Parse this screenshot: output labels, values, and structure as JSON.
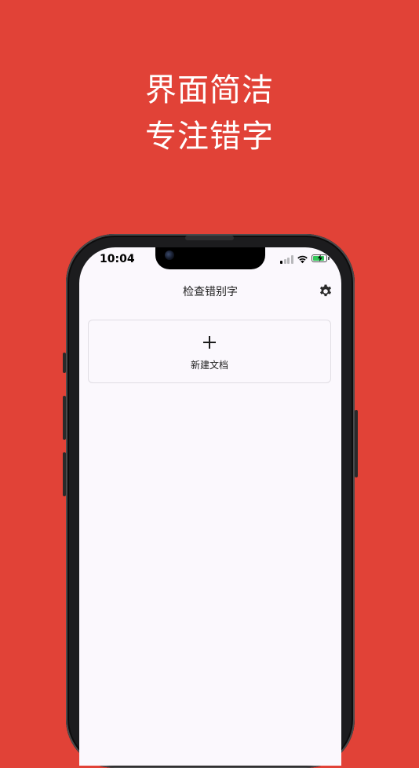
{
  "headline": {
    "line1": "界面简洁",
    "line2": "专注错字"
  },
  "status_bar": {
    "time": "10:04",
    "signal_icon": "cellular-signal-icon",
    "wifi_icon": "wifi-icon",
    "battery_icon": "battery-charging-icon",
    "battery_level": 0.85
  },
  "app": {
    "title": "检查错别字",
    "settings_icon": "gear-icon",
    "new_document": {
      "icon": "plus-icon",
      "label": "新建文档"
    }
  },
  "colors": {
    "background": "#e14237",
    "screen": "#fbf8fd",
    "battery_fill": "#34c759"
  }
}
